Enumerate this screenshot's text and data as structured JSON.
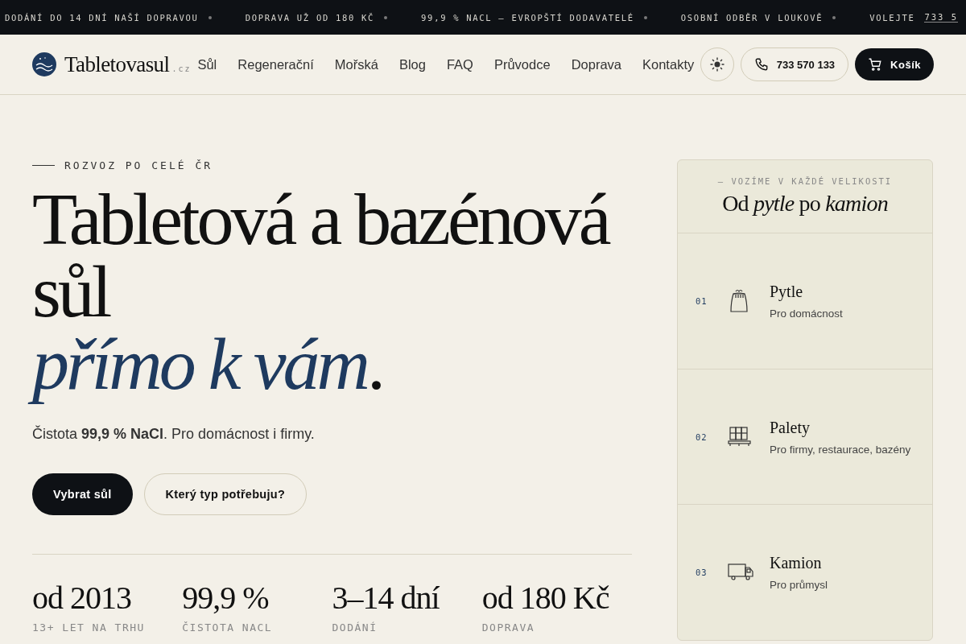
{
  "ticker": [
    {
      "text": "DODÁNÍ DO 14 DNÍ NAŠÍ DOPRAVOU"
    },
    {
      "text": "DOPRAVA UŽ OD 180 KČ"
    },
    {
      "text": "99,9 % NACL — EVROPŠTÍ DODAVATELÉ"
    },
    {
      "text": "OSOBNÍ ODBĚR V LOUKOVĚ"
    }
  ],
  "ticker_call": {
    "label": "VOLEJTE",
    "link": "733 5"
  },
  "header": {
    "logo": "Tabletovasul",
    "logo_suffix": ".cz",
    "nav": [
      "Sůl",
      "Regenerační",
      "Mořská",
      "Blog",
      "FAQ",
      "Průvodce",
      "Doprava",
      "Kontakty"
    ],
    "phone": "733 570 133",
    "cart": "Košík"
  },
  "hero": {
    "eyebrow": "ROZVOZ PO CELÉ ČR",
    "title": "Tabletová a bazénová sůl",
    "title_accent": "přímo k vám",
    "title_end": ".",
    "lead": "Čistota **99,9 % NaCl**. Pro domácnost i firmy.",
    "buttons": [
      {
        "label": "Vybrat sůl",
        "kind": "primary"
      },
      {
        "label": "Který typ potřebuju?",
        "kind": "secondary"
      }
    ],
    "stats": [
      {
        "value": "od 2013",
        "label": "13+ LET NA TRHU"
      },
      {
        "value": "99,9 %",
        "label": "ČISTOTA NACL"
      },
      {
        "value": "3–14 dní",
        "label": "DODÁNÍ"
      },
      {
        "value": "od 180 Kč",
        "label": "DOPRAVA"
      }
    ]
  },
  "card": {
    "eyebrow": "— VOZÍME V KAŽDÉ VELIKOSTI",
    "title": "Od *pytle* po *kamion*",
    "items": [
      {
        "number": "01",
        "kind": "bag",
        "title": "Pytle",
        "text": "Pro domácnost"
      },
      {
        "number": "02",
        "kind": "pallet",
        "title": "Palety",
        "text": "Pro firmy, restaurace, bazény"
      },
      {
        "number": "03",
        "kind": "truck",
        "title": "Kamion",
        "text": "Pro průmysl"
      }
    ]
  }
}
